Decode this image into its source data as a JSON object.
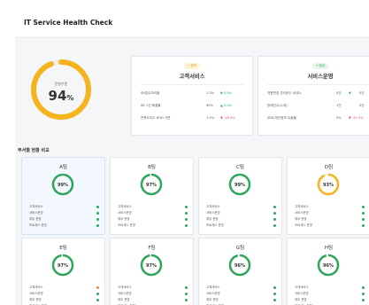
{
  "header": {
    "title": "IT Service Health Check"
  },
  "overall": {
    "label": "운영수준",
    "value": "94",
    "unit": "%",
    "progress": 94,
    "color": "#f5b41d"
  },
  "summary_cards": [
    {
      "badge": "• 경보",
      "title": "고객서비스",
      "badge_bg": "#fff3d6",
      "badge_fg": "#d9961a",
      "metrics": [
        {
          "label": "SR접수처리율",
          "value": "1.3%",
          "change": "▼ 0.0%",
          "dir": "up"
        },
        {
          "label": "SR 1선 해결율",
          "value": "49%",
          "change": "▲ 5.4%",
          "dir": "up"
        },
        {
          "label": "만족도지수 ROD 기준",
          "value": "1.9%",
          "change": "▼ -16.3%",
          "dir": "down"
        }
      ]
    },
    {
      "badge": "• 정상",
      "title": "서비스운영",
      "badge_bg": "#e3f5ea",
      "badge_fg": "#2fa65a",
      "metrics": [
        {
          "label": "자원변경 관리준수 (B/D)",
          "value": "0건",
          "change": "▼",
          "extra": "0건",
          "dir": "up"
        },
        {
          "label": "장애건수(누계)",
          "value": "1건",
          "change": "",
          "extra": "0건",
          "dir": "up"
        },
        {
          "label": "SDS/개인정보 유출율",
          "value": "0%",
          "change": "▼ -41.9%",
          "dir": "down"
        }
      ]
    }
  ],
  "section": {
    "title": "부서별 현황 비교"
  },
  "teams": [
    {
      "name": "A팀",
      "pct": "99%",
      "value": 99,
      "color": "#2fa65a",
      "selected": true,
      "dots": [
        "#2fa65a",
        "#2fa65a",
        "#2fa65a",
        "#2fa65a"
      ]
    },
    {
      "name": "B팀",
      "pct": "97%",
      "value": 97,
      "color": "#2fa65a",
      "selected": false,
      "dots": [
        "#2fa65a",
        "#2fa65a",
        "#2fa65a",
        "#2fa65a"
      ]
    },
    {
      "name": "C팀",
      "pct": "99%",
      "value": 99,
      "color": "#2fa65a",
      "selected": false,
      "dots": [
        "#2fa65a",
        "#2fa65a",
        "#2fa65a",
        "#2fa65a"
      ]
    },
    {
      "name": "D팀",
      "pct": "93%",
      "value": 93,
      "color": "#f5b41d",
      "selected": false,
      "dots": [
        "#2fa65a",
        "#2fa65a",
        "#2fa65a",
        "#2fa65a"
      ]
    },
    {
      "name": "E팀",
      "pct": "97%",
      "value": 97,
      "color": "#2fa65a",
      "selected": false,
      "dots": [
        "#f0883e",
        "#2fa65a",
        "#2fa65a",
        "#2fa65a"
      ]
    },
    {
      "name": "F팀",
      "pct": "97%",
      "value": 97,
      "color": "#2fa65a",
      "selected": false,
      "dots": [
        "#2fa65a",
        "#2fa65a",
        "#2fa65a",
        "#2fa65a"
      ]
    },
    {
      "name": "G팀",
      "pct": "96%",
      "value": 96,
      "color": "#2fa65a",
      "selected": false,
      "dots": [
        "#2fa65a",
        "#2fa65a",
        "#2fa65a",
        "#2fa65a"
      ]
    },
    {
      "name": "H팀",
      "pct": "96%",
      "value": 96,
      "color": "#2fa65a",
      "selected": false,
      "dots": [
        "#2fa65a",
        "#2fa65a",
        "#2fa65a",
        "#2fa65a"
      ]
    }
  ],
  "team_metric_labels": [
    "고객서비스",
    "서비스운영",
    "재무 운영",
    "프로세스 운영"
  ]
}
